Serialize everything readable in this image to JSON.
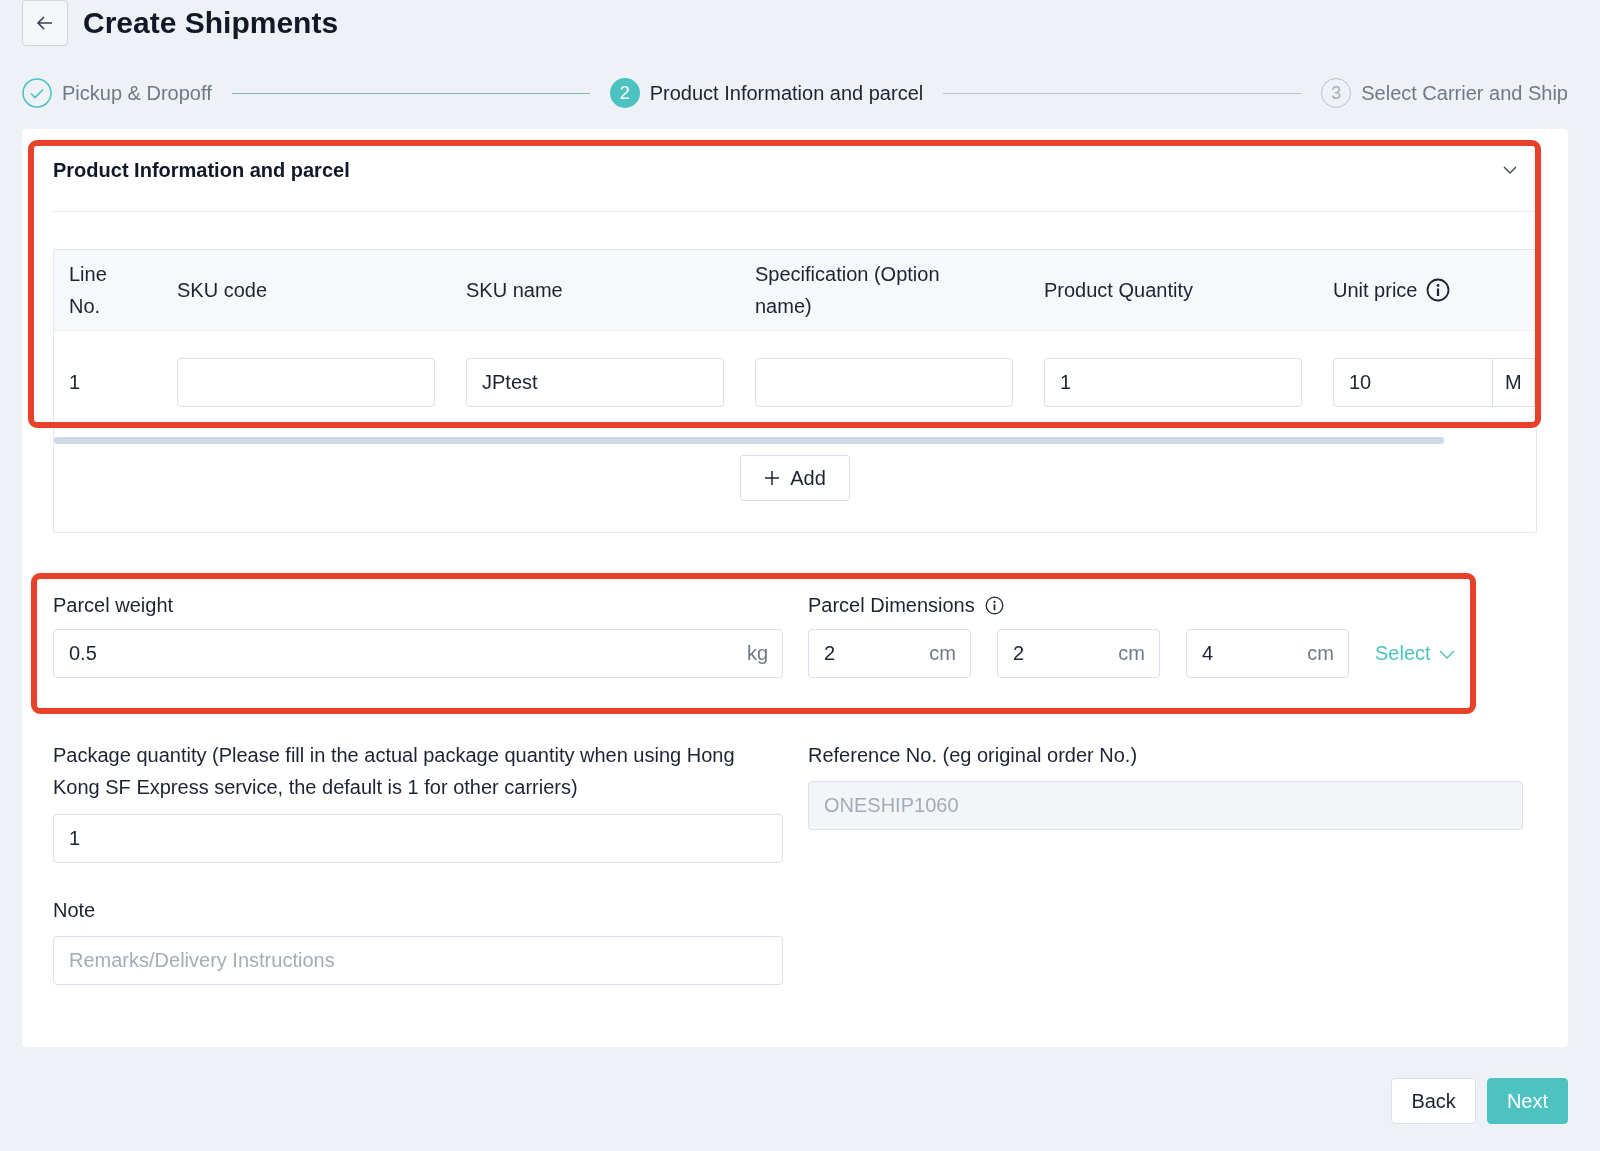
{
  "header": {
    "title": "Create Shipments"
  },
  "steps": [
    {
      "label": "Pickup & Dropoff",
      "completed": true,
      "selected": false
    },
    {
      "number": "2",
      "label": "Product Information and parcel",
      "completed": false,
      "selected": true
    },
    {
      "number": "3",
      "label": "Select Carrier and Ship",
      "completed": false,
      "selected": false
    }
  ],
  "product_section": {
    "title": "Product Information and parcel",
    "expanded": true,
    "highlighted": true,
    "table": {
      "columns": [
        "Line No.",
        "SKU code",
        "SKU name",
        "Specification (Option name)",
        "Product Quantity",
        "Unit price"
      ],
      "rows": [
        {
          "line_no": "1",
          "sku_name": "JPtest",
          "quantity": "1",
          "unit_price": "10",
          "currency": "M"
        }
      ]
    },
    "add_button": "Add"
  },
  "parcel": {
    "highlighted": true,
    "weight": {
      "label": "Parcel weight",
      "value": "0.5",
      "unit": "kg"
    },
    "dimensions": {
      "label": "Parcel Dimensions",
      "fields": [
        {
          "value": "2",
          "unit": "cm"
        },
        {
          "value": "2",
          "unit": "cm"
        },
        {
          "value": "4",
          "unit": "cm"
        }
      ],
      "select": "Select"
    }
  },
  "package_quantity": {
    "label": "Package quantity (Please fill in the actual package quantity when using Hong Kong SF Express service, the default is 1 for other carriers)",
    "value": "1"
  },
  "reference": {
    "label": "Reference No. (eg original order No.)",
    "value": "ONESHIP1060",
    "disabled": true
  },
  "note": {
    "label": "Note",
    "placeholder": "Remarks/Delivery Instructions"
  },
  "actions": [
    {
      "label": "Back",
      "kind": "default"
    },
    {
      "label": "Next",
      "kind": "primary"
    }
  ]
}
